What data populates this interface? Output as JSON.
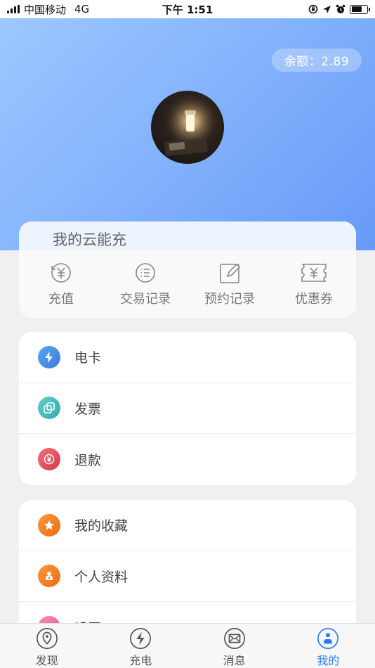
{
  "status_bar": {
    "carrier": "中国移动",
    "network": "4G",
    "time": "下午 1:51"
  },
  "header": {
    "balance_label": "余额：2.89",
    "avatar_icon": "user-avatar-photo"
  },
  "my_section": {
    "title": "我的云能充",
    "actions": [
      {
        "label": "充值",
        "icon": "recharge-yen-icon"
      },
      {
        "label": "交易记录",
        "icon": "transaction-records-icon"
      },
      {
        "label": "预约记录",
        "icon": "reservation-records-icon"
      },
      {
        "label": "优惠券",
        "icon": "coupon-icon"
      }
    ]
  },
  "menu_group_1": [
    {
      "label": "电卡",
      "icon": "lightning-card-icon",
      "color": "#4a90e2"
    },
    {
      "label": "发票",
      "icon": "invoice-icon",
      "color": "#3cbcb8"
    },
    {
      "label": "退款",
      "icon": "refund-icon",
      "color": "#e8455a"
    }
  ],
  "menu_group_2": [
    {
      "label": "我的收藏",
      "icon": "star-icon",
      "color": "#f07a1e"
    },
    {
      "label": "个人资料",
      "icon": "profile-icon",
      "color": "#f07a1e"
    },
    {
      "label": "设置",
      "icon": "settings-icon",
      "color": "#f06aa0"
    }
  ],
  "tab_bar": {
    "tabs": [
      {
        "label": "发现",
        "icon": "location-pin-icon",
        "active": false
      },
      {
        "label": "充电",
        "icon": "charge-bolt-icon",
        "active": false
      },
      {
        "label": "消息",
        "icon": "message-mail-icon",
        "active": false
      },
      {
        "label": "我的",
        "icon": "me-profile-icon",
        "active": true
      }
    ],
    "active_color": "#2d7bf4"
  }
}
